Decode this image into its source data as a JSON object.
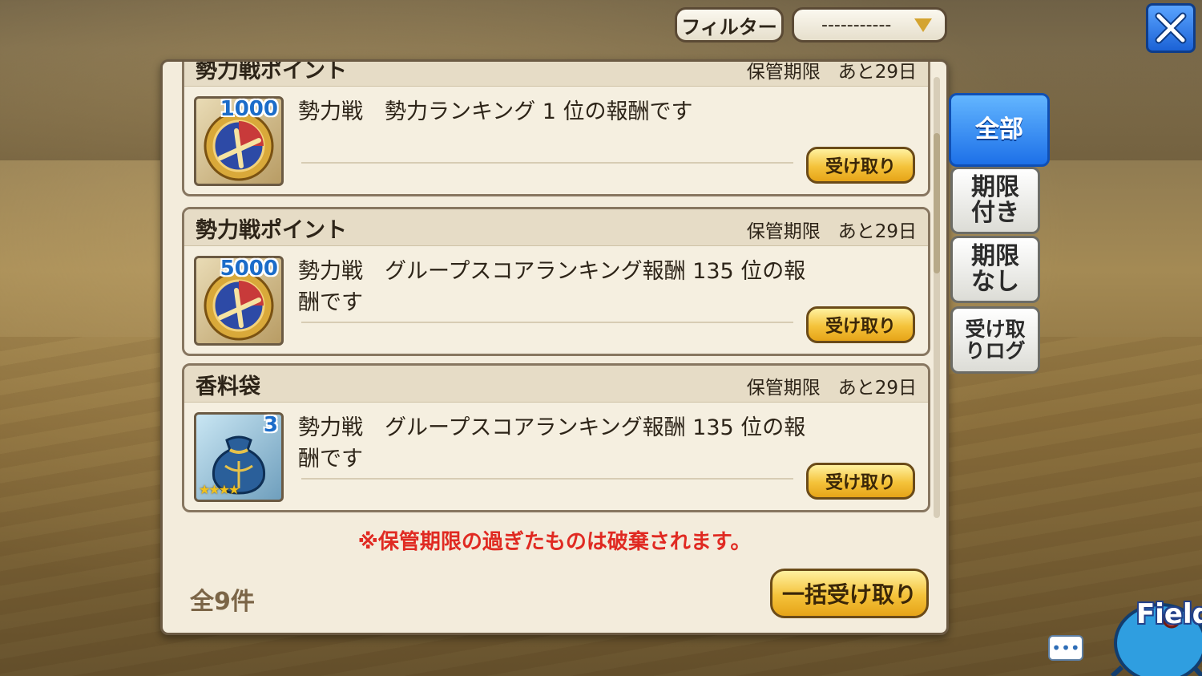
{
  "header": {
    "filter_label": "フィルター",
    "filter_value": "-----------"
  },
  "tabs": [
    {
      "label": "全部",
      "active": true
    },
    {
      "label": "期限付き",
      "active": false
    },
    {
      "label": "期限なし",
      "active": false
    },
    {
      "label": "受け取りログ",
      "active": false
    }
  ],
  "items": [
    {
      "title": "勢力戦ポイント",
      "expire_label": "保管期限",
      "expire_value": "あと29日",
      "count": "1000",
      "icon": "faction-medal-icon",
      "description": "勢力戦　勢力ランキング 1 位の報酬です",
      "button": "受け取り"
    },
    {
      "title": "勢力戦ポイント",
      "expire_label": "保管期限",
      "expire_value": "あと29日",
      "count": "5000",
      "icon": "faction-medal-icon",
      "description": "勢力戦　グループスコアランキング報酬 135 位の報酬です",
      "button": "受け取り"
    },
    {
      "title": "香料袋",
      "expire_label": "保管期限",
      "expire_value": "あと29日",
      "count": "3",
      "icon": "spice-bag-icon",
      "stars": "★★★★",
      "description": "勢力戦　グループスコアランキング報酬 135 位の報酬です",
      "button": "受け取り"
    }
  ],
  "notice": "※保管期限の過ぎたものは破棄されます。",
  "total": "全9件",
  "bulk_button": "一括受け取り",
  "field_button": "Field",
  "chat_icon": "chat-bubble-icon",
  "colors": {
    "accent_blue": "#1d70e8",
    "button_gold": "#f4c23a",
    "notice_red": "#e02a22"
  }
}
